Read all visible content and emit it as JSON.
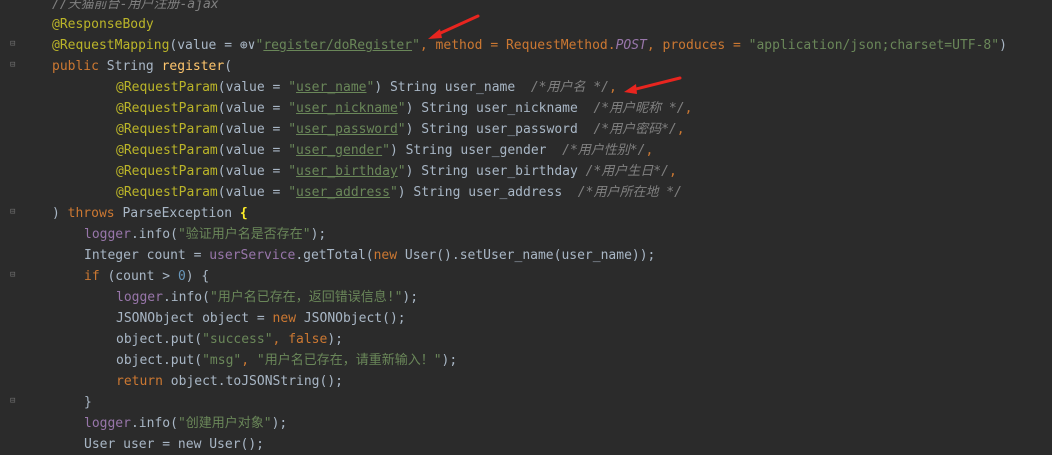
{
  "lines": {
    "l0": "//天猫前台-用户注册-ajax",
    "l1_ann": "@ResponseBody",
    "l2_ann": "@RequestMapping",
    "l2_a": "(value = ",
    "l2_globe": "⊕∨",
    "l2_q1": "\"",
    "l2_url": "register/doRegister",
    "l2_q2": "\"",
    "l2_b": ", method = RequestMethod.",
    "l2_post": "POST",
    "l2_c": ", produces = ",
    "l2_str": "\"application/json;charset=UTF-8\"",
    "l2_d": ")",
    "l3_kw": "public",
    "l3_a": " String ",
    "l3_fn": "register",
    "l3_b": "(",
    "params": [
      {
        "url": "user_name",
        "type": " String user_name  ",
        "comment": "/*用户名 */",
        "tail": ","
      },
      {
        "url": "user_nickname",
        "type": " String user_nickname  ",
        "comment": "/*用户昵称 */",
        "tail": ","
      },
      {
        "url": "user_password",
        "type": " String user_password  ",
        "comment": "/*用户密码*/",
        "tail": ","
      },
      {
        "url": "user_gender",
        "type": " String user_gender  ",
        "comment": "/*用户性别*/",
        "tail": ","
      },
      {
        "url": "user_birthday",
        "type": " String user_birthday ",
        "comment": "/*用户生日*/",
        "tail": ","
      },
      {
        "url": "user_address",
        "type": " String user_address  ",
        "comment": "/*用户所在地 */",
        "tail": ""
      }
    ],
    "param_ann": "@RequestParam",
    "param_open": "(value = ",
    "param_close": ")",
    "l10_a": ") ",
    "l10_kw": "throws",
    "l10_b": " ParseException ",
    "l10_brace": "{",
    "l11_fld": "logger",
    "l11_a": ".info(",
    "l11_str": "\"验证用户名是否存在\"",
    "l11_b": ");",
    "l12_a": "Integer count = ",
    "l12_fld": "userService",
    "l12_b": ".getTotal(",
    "l12_kw": "new",
    "l12_c": " User().setUser_name(user_name));",
    "l13_kw": "if",
    "l13_a": " (count > ",
    "l13_num": "0",
    "l13_b": ") {",
    "l14_fld": "logger",
    "l14_a": ".info(",
    "l14_str": "\"用户名已存在，返回错误信息!\"",
    "l14_b": ");",
    "l15_a": "JSONObject object = ",
    "l15_kw": "new",
    "l15_b": " JSONObject();",
    "l16_a": "object.put(",
    "l16_str": "\"success\"",
    "l16_b": ", ",
    "l16_kw": "false",
    "l16_c": ");",
    "l17_a": "object.put(",
    "l17_str1": "\"msg\"",
    "l17_b": ", ",
    "l17_str2": "\"用户名已存在，请重新输入！\"",
    "l17_c": ");",
    "l18_kw": "return",
    "l18_a": " object.toJSONString();",
    "l19": "}",
    "l20_fld": "logger",
    "l20_a": ".info(",
    "l20_str": "\"创建用户对象\"",
    "l20_b": ");",
    "l21_partial": "User user = new User();"
  },
  "colors": {
    "background": "#2b2b2b",
    "annotation": "#bbb529",
    "keyword": "#cc7832",
    "string": "#6a8759",
    "arrow": "#e8251f"
  },
  "icons": [
    "globe-icon",
    "fold-marker-icon",
    "red-arrow-icon"
  ]
}
